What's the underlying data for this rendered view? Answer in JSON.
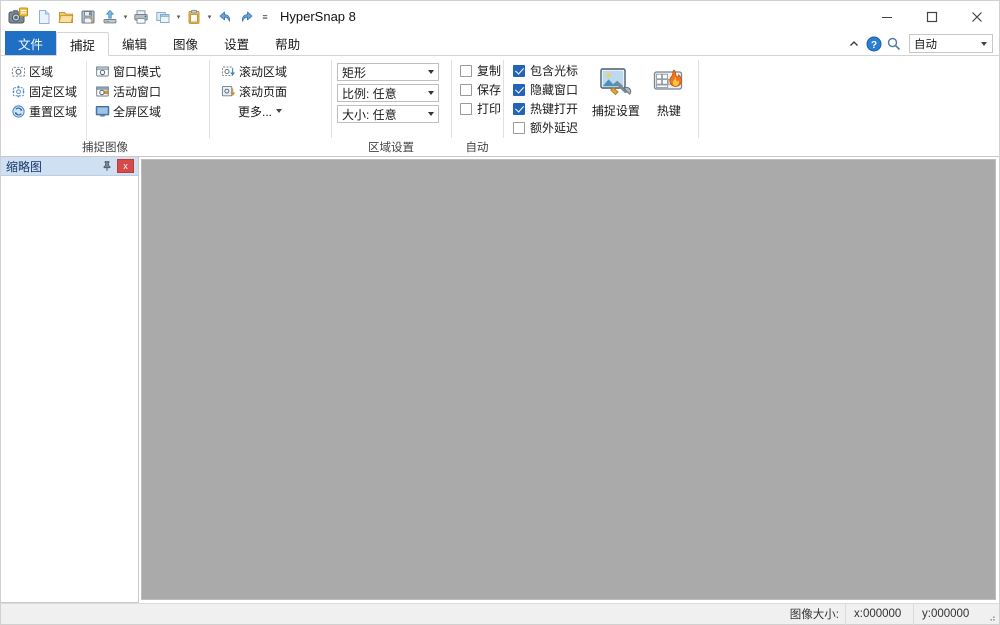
{
  "window": {
    "title": "HyperSnap 8",
    "app_icon": "camera-icon",
    "controls": {
      "minimize": "minimize-icon",
      "maximize": "maximize-icon",
      "close": "close-icon"
    }
  },
  "quick_access": [
    {
      "name": "new-document-icon",
      "label": "新建",
      "dropdown": false
    },
    {
      "name": "open-folder-icon",
      "label": "打开",
      "dropdown": false
    },
    {
      "name": "save-floppy-icon",
      "label": "保存",
      "dropdown": false
    },
    {
      "name": "upload-icon",
      "label": "上传",
      "dropdown": true
    },
    {
      "name": "print-icon",
      "label": "打印",
      "dropdown": false
    },
    {
      "name": "copy-window-icon",
      "label": "复制",
      "dropdown": true
    },
    {
      "name": "clipboard-paste-icon",
      "label": "粘贴",
      "dropdown": true
    },
    {
      "name": "undo-icon",
      "label": "撤销",
      "dropdown": false
    },
    {
      "name": "redo-icon",
      "label": "重做",
      "dropdown": false
    }
  ],
  "quick_access_overflow": "customize-quick-access-icon",
  "tabs": [
    {
      "label": "文件",
      "state": "file"
    },
    {
      "label": "捕捉",
      "state": "active"
    },
    {
      "label": "编辑",
      "state": "normal"
    },
    {
      "label": "图像",
      "state": "normal"
    },
    {
      "label": "设置",
      "state": "normal"
    },
    {
      "label": "帮助",
      "state": "normal"
    }
  ],
  "ribbon_right": {
    "collapse_icon": "chevron-up-icon",
    "help_icon": "help-circle-icon",
    "search_icon": "magnifier-icon",
    "mode_combo_value": "自动"
  },
  "ribbon": {
    "groups": [
      {
        "label": "捕捉图像",
        "col1": [
          {
            "label": "区域",
            "icon": "region-capture-icon"
          },
          {
            "label": "固定区域",
            "icon": "fixed-region-icon"
          },
          {
            "label": "重置区域",
            "icon": "repeat-region-icon"
          }
        ],
        "col2": [
          {
            "label": "窗口模式",
            "icon": "window-mode-icon"
          },
          {
            "label": "活动窗口",
            "icon": "active-window-icon"
          },
          {
            "label": "全屏区域",
            "icon": "full-screen-icon"
          }
        ]
      },
      {
        "label": "区域设置",
        "col1": [
          {
            "label": "滚动区域",
            "icon": "scroll-region-icon",
            "dropdown": false
          },
          {
            "label": "滚动页面",
            "icon": "scroll-page-icon",
            "dropdown": false
          },
          {
            "label": "更多...",
            "icon": "none",
            "dropdown": true
          }
        ],
        "combos": [
          {
            "value": "矩形",
            "name": "shape-combo"
          },
          {
            "value": "比例: 任意",
            "name": "ratio-combo"
          },
          {
            "value": "大小: 任意",
            "name": "size-combo"
          }
        ]
      },
      {
        "label": "自动",
        "checkboxes": [
          {
            "label": "复制",
            "checked": false
          },
          {
            "label": "保存",
            "checked": false
          },
          {
            "label": "打印",
            "checked": false
          }
        ]
      },
      {
        "label": "",
        "checkboxes": [
          {
            "label": "包含光标",
            "checked": true
          },
          {
            "label": "隐藏窗口",
            "checked": true
          },
          {
            "label": "热键打开",
            "checked": true
          },
          {
            "label": "额外延迟",
            "checked": false
          }
        ],
        "buttons": [
          {
            "label": "捕捉设置",
            "icon": "capture-settings-icon"
          },
          {
            "label": "热键",
            "icon": "hotkey-flame-icon"
          }
        ]
      }
    ]
  },
  "thumbnail_panel": {
    "title": "缩略图",
    "pin_icon": "pin-icon",
    "close_label": "x"
  },
  "status_bar": {
    "image_size_label": "图像大小:",
    "x_value": "x:000000",
    "y_value": "y:000000"
  },
  "colors": {
    "accent_blue": "#1f6fc4",
    "canvas_gray": "#aaaaaa",
    "panel_header": "#cfe0f2",
    "checkbox_checked": "#2364b8",
    "close_red": "#d64a4a"
  }
}
